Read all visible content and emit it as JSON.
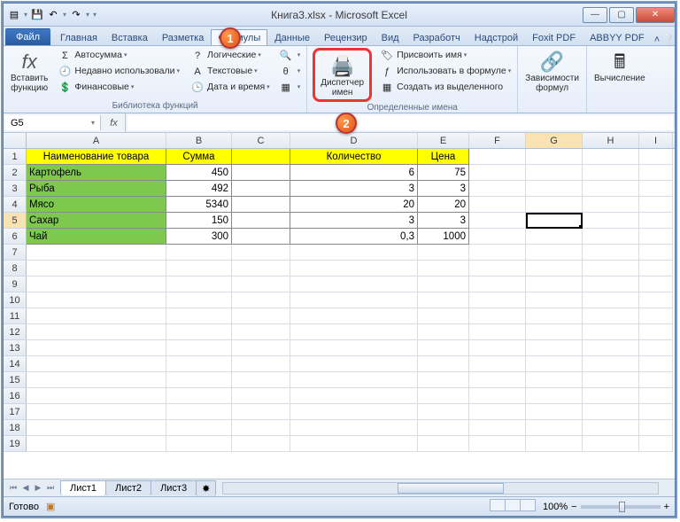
{
  "window": {
    "doc": "Книга3.xlsx",
    "app": "Microsoft Excel",
    "title_sep": " - "
  },
  "tabs": {
    "file": "Файл",
    "items": [
      "Главная",
      "Вставка",
      "Разметка",
      "Формулы",
      "Данные",
      "Рецензир",
      "Вид",
      "Разработч",
      "Надстрой",
      "Foxit PDF",
      "ABBYY PDF"
    ],
    "active_index": 3
  },
  "ribbon": {
    "insert_fn": {
      "label": "Вставить\nфункцию",
      "glyph": "fx"
    },
    "lib_group_label": "Библиотека функций",
    "lib_col1": [
      "Автосумма",
      "Недавно использовали",
      "Финансовые"
    ],
    "lib_col2": [
      "Логические",
      "Текстовые",
      "Дата и время"
    ],
    "name_manager": "Диспетчер\nимен",
    "names_group_label": "Определенные имена",
    "names_items": [
      "Присвоить имя",
      "Использовать в формуле",
      "Создать из выделенного"
    ],
    "dep_label": "Зависимости\nформул",
    "calc_label": "Вычисление"
  },
  "namebox": "G5",
  "fx_label": "fx",
  "grid": {
    "cols": [
      "A",
      "B",
      "C",
      "D",
      "E",
      "F",
      "G",
      "H",
      "I"
    ],
    "headers": [
      "Наименование товара",
      "Сумма",
      "",
      "Количество",
      "Цена"
    ],
    "rows": [
      {
        "name": "Картофель",
        "b": "450",
        "c": "",
        "d": "6",
        "e": "75"
      },
      {
        "name": "Рыба",
        "b": "492",
        "c": "",
        "d": "3",
        "e": "3"
      },
      {
        "name": "Мясо",
        "b": "5340",
        "c": "",
        "d": "20",
        "e": "20"
      },
      {
        "name": "Сахар",
        "b": "150",
        "c": "",
        "d": "3",
        "e": "3"
      },
      {
        "name": "Чай",
        "b": "300",
        "c": "",
        "d": "0,3",
        "e": "1000"
      }
    ],
    "selected_col": "G",
    "selected_row": 5
  },
  "sheets": [
    "Лист1",
    "Лист2",
    "Лист3"
  ],
  "status": {
    "ready": "Готово",
    "zoom": "100%"
  },
  "callouts": {
    "one": "1",
    "two": "2"
  }
}
